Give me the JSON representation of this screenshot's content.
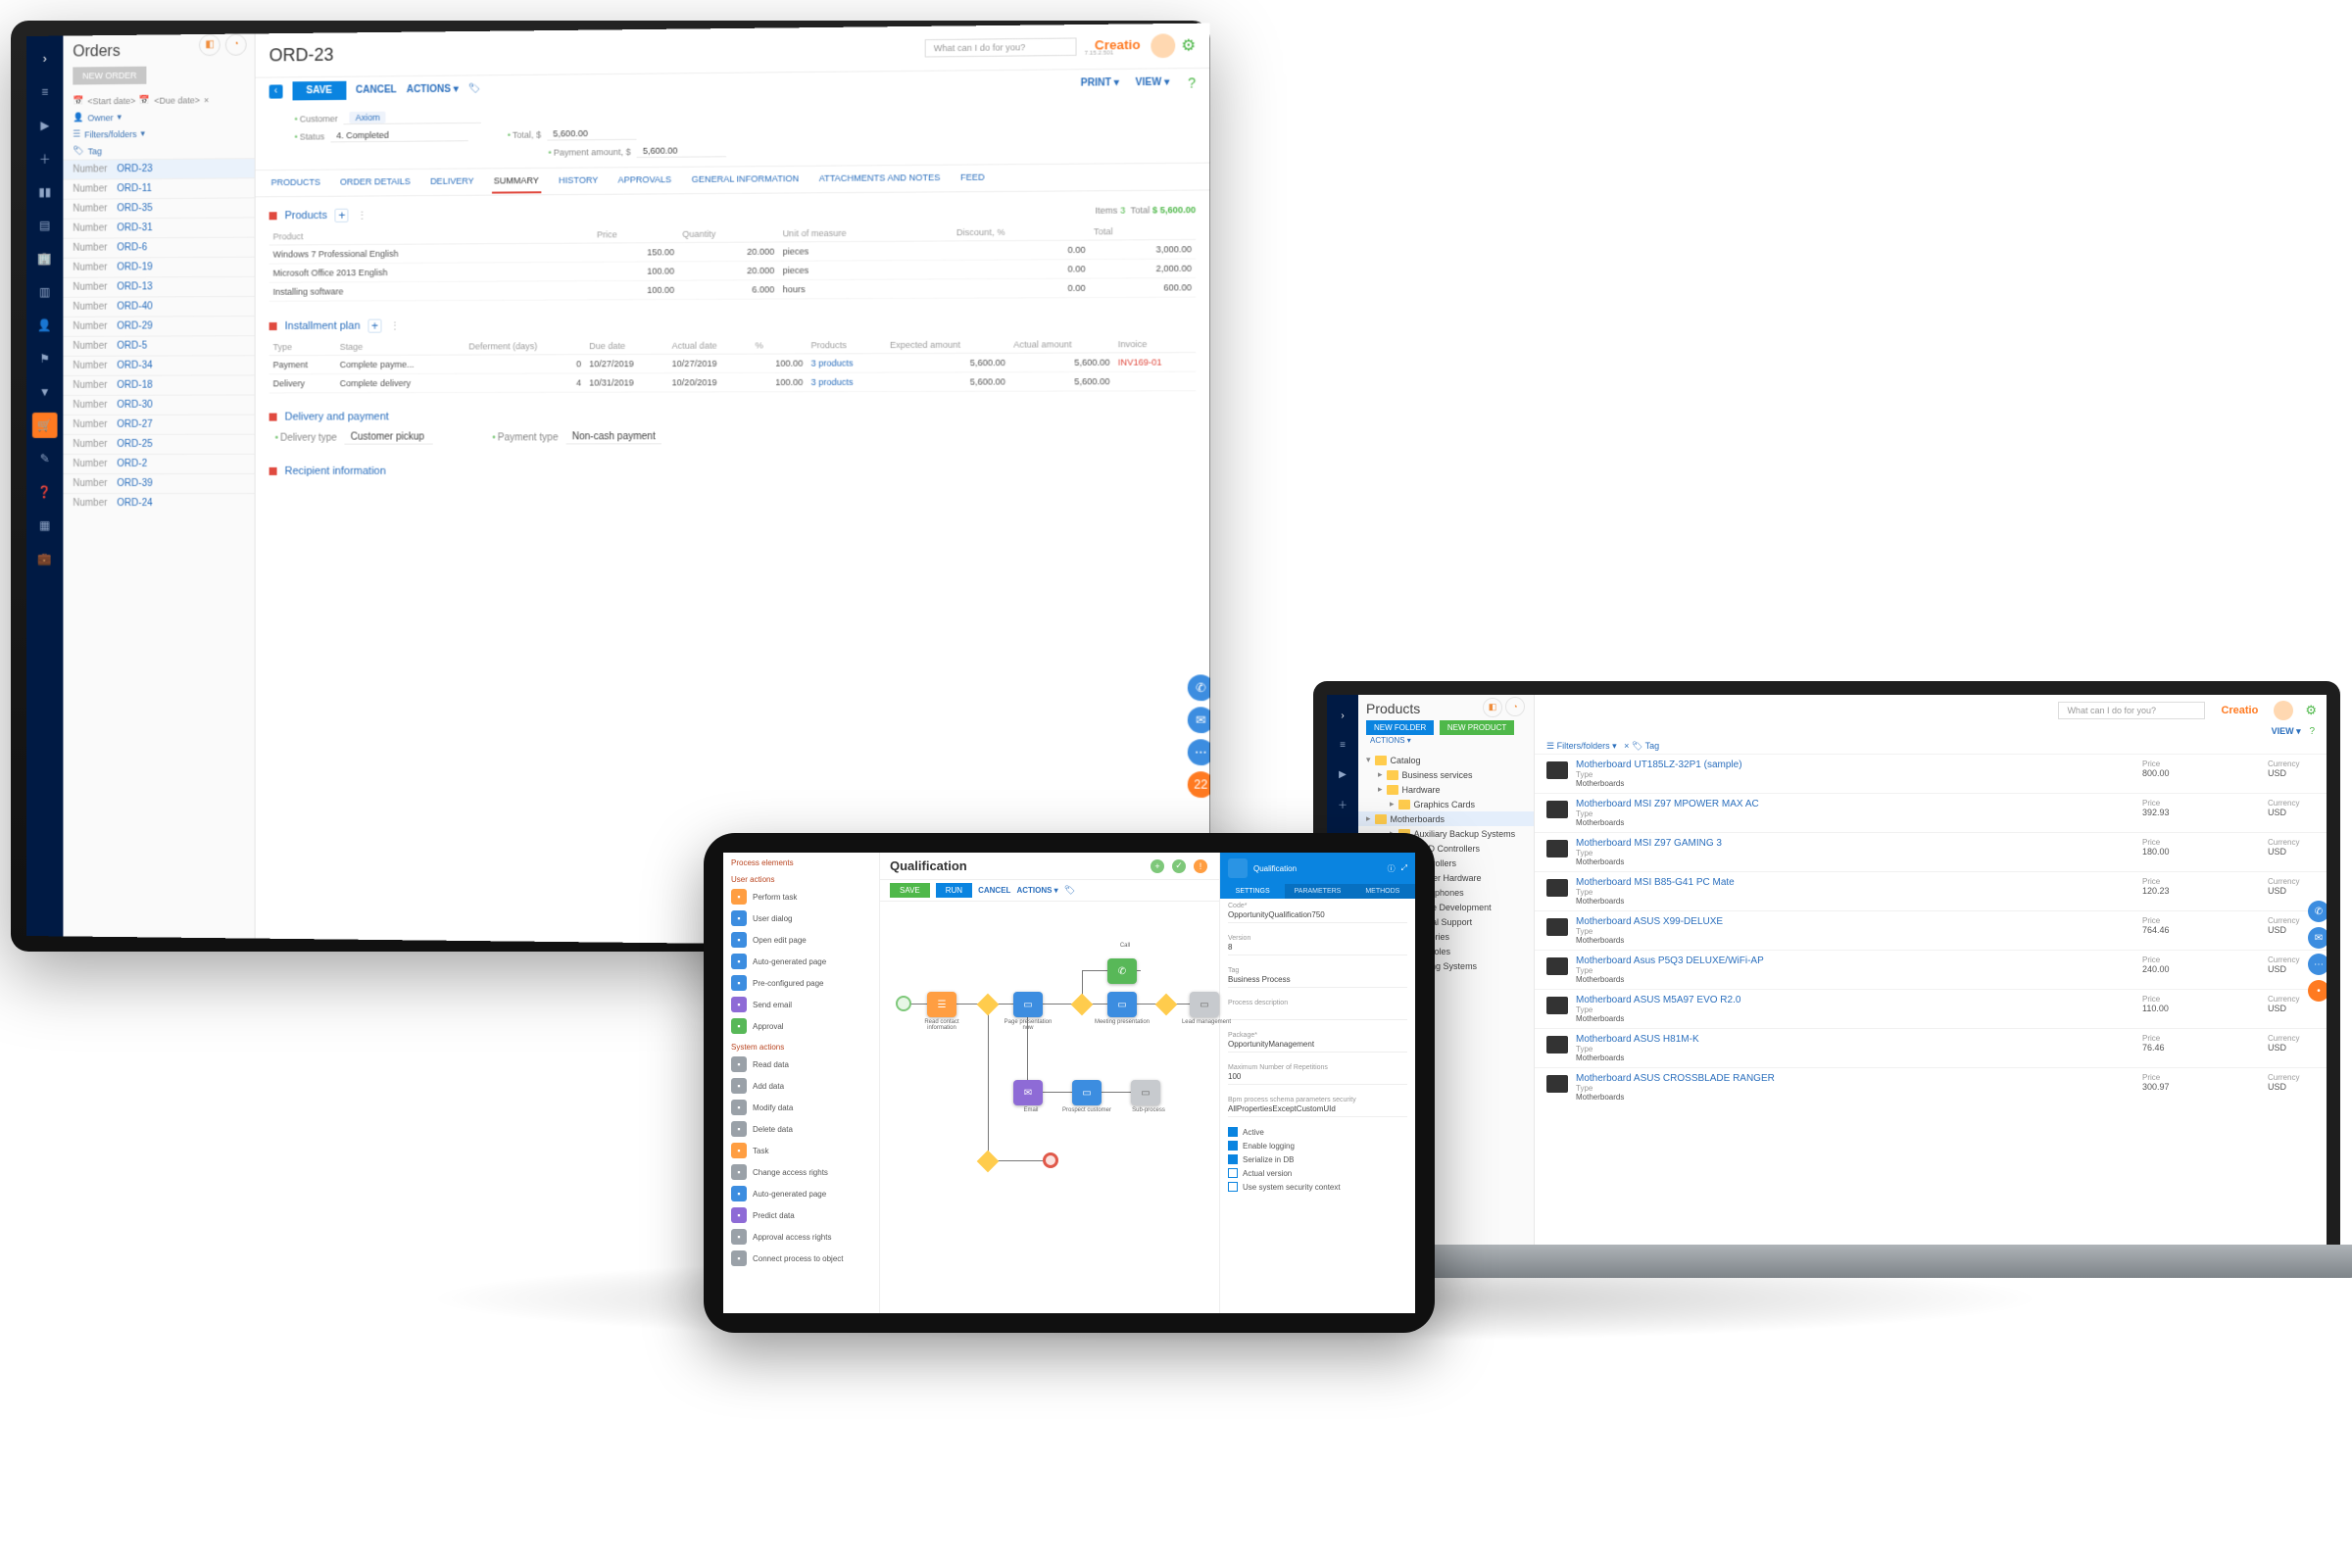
{
  "brand": {
    "name": "Creatio",
    "sub": "7.15.2.501"
  },
  "search": {
    "placeholder": "What can I do for you?"
  },
  "monitor": {
    "orders": {
      "title": "Orders",
      "new_btn": "NEW ORDER",
      "num_lbl": "Number",
      "filters": {
        "start": "<Start date>",
        "due": "<Due date>",
        "owner": "Owner",
        "ff": "Filters/folders",
        "tag": "Tag"
      },
      "rows": [
        "ORD-23",
        "ORD-11",
        "ORD-35",
        "ORD-31",
        "ORD-6",
        "ORD-19",
        "ORD-13",
        "ORD-40",
        "ORD-29",
        "ORD-5",
        "ORD-34",
        "ORD-18",
        "ORD-30",
        "ORD-27",
        "ORD-25",
        "ORD-2",
        "ORD-39",
        "ORD-24"
      ]
    },
    "detail": {
      "title": "ORD-23",
      "save": "SAVE",
      "cancel": "CANCEL",
      "actions": "ACTIONS",
      "print": "PRINT",
      "view": "VIEW",
      "customer_lbl": "Customer",
      "customer": "Axiom",
      "status_lbl": "Status",
      "status": "4. Completed",
      "total_lbl": "Total, $",
      "total": "5,600.00",
      "pay_lbl": "Payment amount, $",
      "pay": "5,600.00",
      "tabs": [
        "PRODUCTS",
        "ORDER DETAILS",
        "DELIVERY",
        "SUMMARY",
        "HISTORY",
        "APPROVALS",
        "GENERAL INFORMATION",
        "ATTACHMENTS AND NOTES",
        "FEED"
      ],
      "active_tab": "SUMMARY",
      "products": {
        "h": "Products",
        "items_meta": "Items",
        "items": "3",
        "total_lbl": "Total",
        "total": "$ 5,600.00",
        "cols": [
          "Product",
          "Price",
          "Quantity",
          "Unit of measure",
          "Discount, %",
          "Total"
        ],
        "rows": [
          {
            "p": "Windows 7 Professional English",
            "pr": "150.00",
            "q": "20.000",
            "u": "pieces",
            "d": "0.00",
            "t": "3,000.00"
          },
          {
            "p": "Microsoft Office 2013 English",
            "pr": "100.00",
            "q": "20.000",
            "u": "pieces",
            "d": "0.00",
            "t": "2,000.00"
          },
          {
            "p": "Installing software",
            "pr": "100.00",
            "q": "6.000",
            "u": "hours",
            "d": "0.00",
            "t": "600.00"
          }
        ]
      },
      "install": {
        "h": "Installment plan",
        "cols": [
          "Type",
          "Stage",
          "Deferment (days)",
          "Due date",
          "Actual date",
          "%",
          "Products",
          "Expected amount",
          "Actual amount",
          "Invoice"
        ],
        "rows": [
          {
            "t": "Payment",
            "s": "Complete payme...",
            "d": "0",
            "dd": "10/27/2019",
            "ad": "10/27/2019",
            "p": "100.00",
            "pr": "3 products",
            "ea": "5,600.00",
            "aa": "5,600.00",
            "inv": "INV169-01"
          },
          {
            "t": "Delivery",
            "s": "Complete delivery",
            "d": "4",
            "dd": "10/31/2019",
            "ad": "10/20/2019",
            "p": "100.00",
            "pr": "3 products",
            "ea": "5,600.00",
            "aa": "5,600.00",
            "inv": ""
          }
        ]
      },
      "delivery": {
        "h": "Delivery and payment",
        "dtype_lbl": "Delivery type",
        "dtype": "Customer pickup",
        "ptype_lbl": "Payment type",
        "ptype": "Non-cash payment"
      },
      "recipient": {
        "h": "Recipient information"
      }
    }
  },
  "tablet": {
    "pe_title": "Process elements",
    "ua_title": "User actions",
    "sa_title": "System actions",
    "ua": [
      "Perform task",
      "User dialog",
      "Open edit page",
      "Auto-generated page",
      "Pre-configured page",
      "Send email",
      "Approval"
    ],
    "sa": [
      "Read data",
      "Add data",
      "Modify data",
      "Delete data",
      "Task",
      "Change access rights",
      "Auto-generated page",
      "Predict data",
      "Approval access rights",
      "Connect process to object"
    ],
    "center": {
      "title": "Qualification",
      "save": "SAVE",
      "run": "RUN",
      "cancel": "CANCEL",
      "actions": "ACTIONS",
      "nodes": {
        "start": "",
        "task1": "Read contact information",
        "task2": "Page presentation now",
        "gw1": "",
        "call": "Call",
        "meet": "Meeting presentation",
        "task3": "Lead management",
        "pres": "Prospect customer",
        "sub": "Sub-process",
        "mail": "Email",
        "end": ""
      }
    },
    "props": {
      "title": "Qualification",
      "tabs": [
        "SETTINGS",
        "PARAMETERS",
        "METHODS"
      ],
      "code_lbl": "Code*",
      "code": "OpportunityQualification750",
      "ver_lbl": "Version",
      "ver": "8",
      "tag_lbl": "Tag",
      "tag": "Business Process",
      "desc_lbl": "Process description",
      "pkg_lbl": "Package*",
      "pkg": "OpportunityManagement",
      "max_lbl": "Maximum Number of Repetitions",
      "max": "100",
      "lvl_lbl": "Bpm process schema parameters security",
      "lvl": "AllPropertiesExceptCustomUId",
      "cb": [
        "Active",
        "Enable logging",
        "Serialize in DB",
        "Actual version",
        "Use system security context"
      ]
    }
  },
  "laptop": {
    "title": "Products",
    "nf": "NEW FOLDER",
    "np": "NEW PRODUCT",
    "act": "ACTIONS",
    "view": "VIEW",
    "ff": "Filters/folders",
    "tag": "Tag",
    "tree": [
      "Catalog",
      "Business services",
      "Hardware",
      "Graphics Cards",
      "Motherboards",
      "Auxiliary Backup Systems",
      "RAID Controllers",
      "Controllers",
      "Computer Hardware",
      "Headphones",
      "Software Development",
      "Technical Support",
      "Accessories",
      "Consoles",
      "Operating Systems"
    ],
    "cols": {
      "type": "Type",
      "price": "Price",
      "cur": "Currency"
    },
    "type_val": "Motherboards",
    "cur_val": "USD",
    "rows": [
      {
        "n": "Motherboard UT185LZ-32P1 (sample)",
        "p": "800.00"
      },
      {
        "n": "Motherboard MSI Z97 MPOWER MAX AC",
        "p": "392.93"
      },
      {
        "n": "Motherboard MSI Z97 GAMING 3",
        "p": "180.00"
      },
      {
        "n": "Motherboard MSI B85-G41 PC Mate",
        "p": "120.23"
      },
      {
        "n": "Motherboard ASUS X99-DELUXE",
        "p": "764.46"
      },
      {
        "n": "Motherboard Asus P5Q3 DELUXE/WiFi-AP",
        "p": "240.00"
      },
      {
        "n": "Motherboard ASUS M5A97 EVO R2.0",
        "p": "110.00"
      },
      {
        "n": "Motherboard ASUS H81M-K",
        "p": "76.46"
      },
      {
        "n": "Motherboard ASUS CROSSBLADE RANGER",
        "p": "300.97"
      }
    ]
  }
}
